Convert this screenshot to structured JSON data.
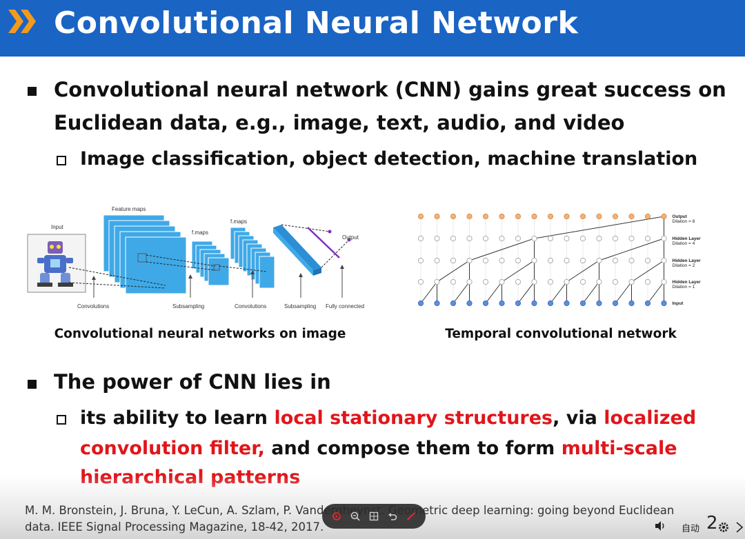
{
  "slide": {
    "title": "Convolutional Neural Network",
    "bullet1": {
      "line1": "Convolutional neural network (CNN) gains great success on",
      "line2": "Euclidean data, e.g., image, text, audio, and video",
      "sub": "Image classification, object detection, machine translation"
    },
    "figure_left": {
      "caption": "Convolutional neural networks on image",
      "labels": {
        "input": "Input",
        "feature_maps": "Feature maps",
        "fmaps1": "f.maps",
        "fmaps2": "f.maps",
        "output": "Output",
        "convolutions1": "Convolutions",
        "subsampling1": "Subsampling",
        "convolutions2": "Convolutions",
        "subsampling2": "Subsampling",
        "fully_connected": "Fully connected"
      }
    },
    "figure_right": {
      "caption": "Temporal convolutional network",
      "layers": [
        {
          "name": "Output",
          "note": "Dilation = 8"
        },
        {
          "name": "Hidden Layer",
          "note": "Dilation = 4"
        },
        {
          "name": "Hidden Layer",
          "note": "Dilation = 2"
        },
        {
          "name": "Hidden Layer",
          "note": "Dilation = 1"
        },
        {
          "name": "Input",
          "note": ""
        }
      ]
    },
    "bullet2": {
      "heading": "The power of CNN lies in",
      "p1": "its ability to learn ",
      "r1": "local stationary structures",
      "p2": ", via ",
      "r2": "localized",
      "r3": "convolution filter,",
      "p3": " and compose them to form ",
      "r4": "multi-scale",
      "r5": "hierarchical patterns"
    },
    "reference": {
      "line1": "M. M. Bronstein, J. Bruna, Y. LeCun, A. Szlam, P. Vandergheynst. Geometric deep learning: going beyond Euclidean",
      "line2": "data. IEEE Signal Processing Magazine, 18-42, 2017."
    },
    "page_number": "2"
  },
  "player": {
    "auto_label": "自动",
    "toolbar_icons": [
      "pointer-icon",
      "zoom-out-icon",
      "grid-icon",
      "undo-icon",
      "pen-icon"
    ]
  },
  "colors": {
    "title_bar": "#1a64c4",
    "chevron": "#f39a1e",
    "highlight_red": "#e0161b",
    "feature_map_blue": "#3fa9e8",
    "tcn_output": "#f2b27a",
    "tcn_input": "#5b8ee0"
  }
}
